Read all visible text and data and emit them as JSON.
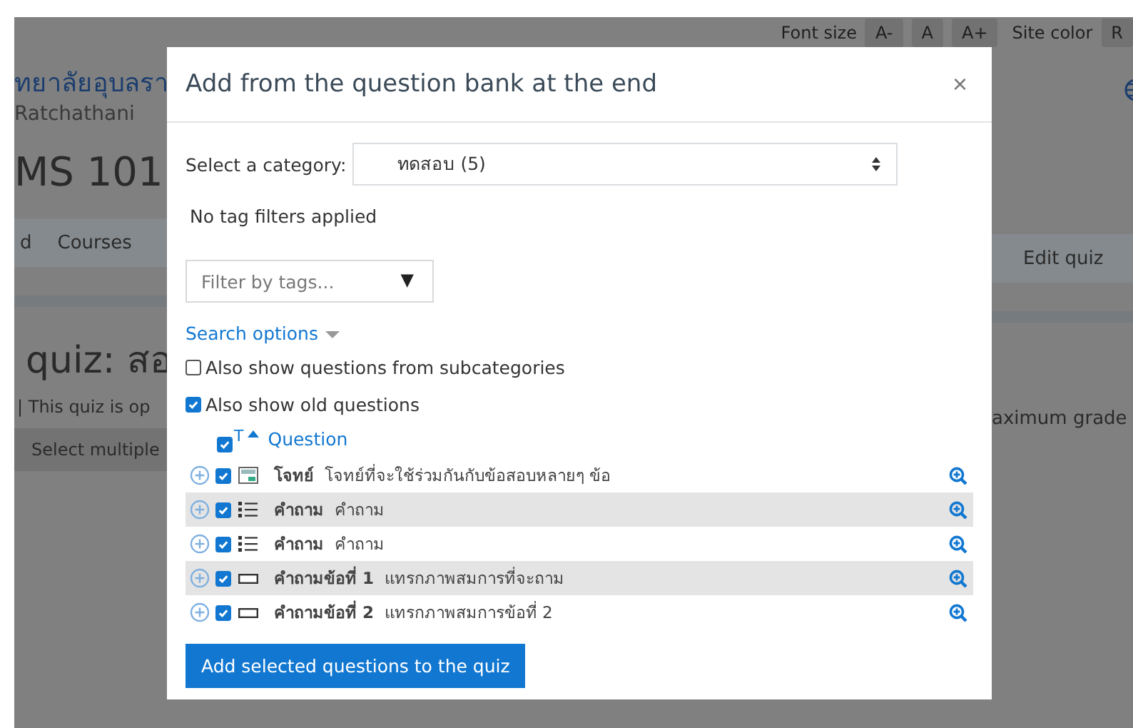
{
  "top_bar": {
    "font_size_label": "Font size",
    "font_size_buttons": [
      "A-",
      "A",
      "A+"
    ],
    "site_color_label": "Site color",
    "site_color_buttons": [
      "R"
    ]
  },
  "background_page": {
    "logo_thai": "ทยาลัยอุบลรา",
    "logo_english": "Ratchathani",
    "course_title": "MS 101",
    "breadcrumb_left": [
      "d",
      "Courses"
    ],
    "breadcrumb_right": [
      "Edit quiz"
    ],
    "heading": "quiz: สอ",
    "info": "| This quiz is op",
    "select_multiple": "Select multiple",
    "max_grade": "aximum grade"
  },
  "dialog": {
    "title": "Add from the question bank at the end",
    "close": "×",
    "category_label": "Select a category:",
    "category_value": "ทดสอบ (5)",
    "tag_status": "No tag filters applied",
    "tag_filter": {
      "placeholder": "Filter by tags...",
      "arrow": "▼"
    },
    "search_options": "Search options",
    "options": [
      {
        "label": "Also show questions from subcategories",
        "checked": false
      },
      {
        "label": "Also show old questions",
        "checked": true
      }
    ],
    "table": {
      "header_checked": true,
      "type_column": "T",
      "question_column": "Question",
      "rows": [
        {
          "kind": "description",
          "checked": true,
          "name": "โจทย์",
          "text": "โจทย์ที่จะใช้ร่วมกันกับข้อสอบหลายๆ ข้อ"
        },
        {
          "kind": "multichoice",
          "checked": true,
          "name": "คำถาม",
          "text": "คำถาม"
        },
        {
          "kind": "multichoice",
          "checked": true,
          "name": "คำถาม",
          "text": "คำถาม"
        },
        {
          "kind": "shortanswer",
          "checked": true,
          "name": "คำถามข้อที่ 1",
          "text": "แทรกภาพสมการที่จะถาม"
        },
        {
          "kind": "shortanswer",
          "checked": true,
          "name": "คำถามข้อที่ 2",
          "text": "แทรกภาพสมการข้อที่ 2"
        }
      ]
    },
    "add_button": "Add selected questions to the quiz"
  }
}
